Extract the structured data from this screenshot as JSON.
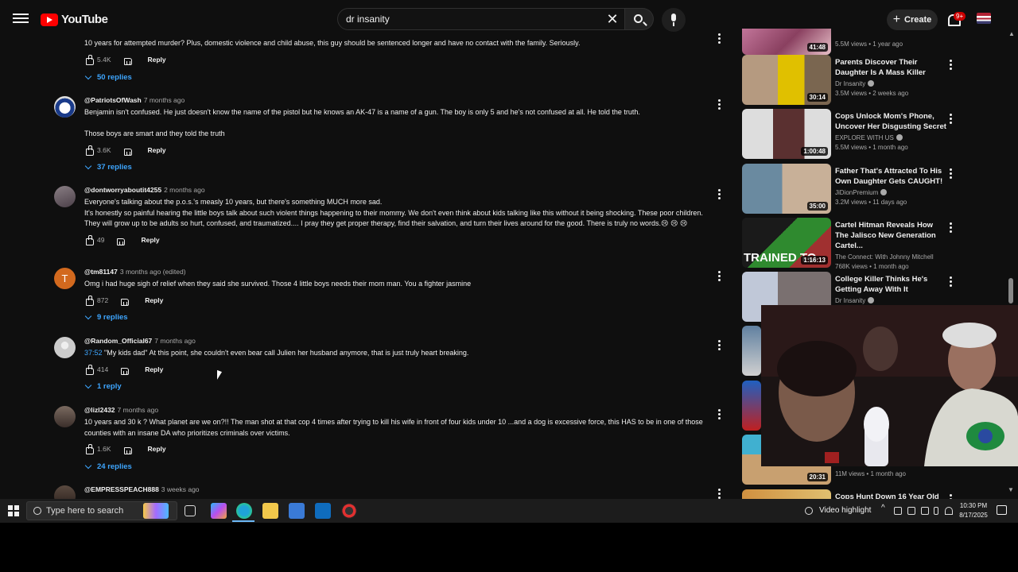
{
  "header": {
    "logo_text": "YouTube",
    "search_value": "dr insanity",
    "create_label": "Create",
    "notifications_badge": "9+"
  },
  "comments": [
    {
      "user": "",
      "time": "",
      "text": "10 years for attempted murder? Plus, domestic violence and child abuse,  this guy should be sentenced longer and have no contact with the family. Seriously.",
      "likes": "5.4K",
      "reply_label": "Reply",
      "replies": "50 replies"
    },
    {
      "user": "@PatriotsOfWash",
      "time": "7 months ago",
      "text": "Benjamin isn't confused. He just doesn't know the name of the pistol but he knows an AK-47 is a name of a gun. The boy is only 5 and he's not confused at all. He told the truth.\n\nThose boys are smart and they told the truth",
      "likes": "3.6K",
      "reply_label": "Reply",
      "replies": "37 replies"
    },
    {
      "user": "@dontworryaboutit4255",
      "time": "2 months ago",
      "text": "Everyone's talking about the p.o.s.'s measly 10 years, but there's something MUCH more sad.\nIt's honestly so painful hearing the little boys talk about such violent things happening to their mommy. We don't even think about kids talking like this without it being shocking. These poor children. They will grow up to be adults so hurt, confused, and traumatized.... I pray they get proper therapy, find their salvation, and turn their lives around for the good. There is truly no words.😢 😢 😢",
      "likes": "49",
      "reply_label": "Reply",
      "replies": ""
    },
    {
      "user": "@tm81147",
      "time": "3 months ago (edited)",
      "text": "Omg i had huge sigh of relief when they said she survived. Those 4 little boys needs their mom man. You a fighter jasmine",
      "likes": "872",
      "reply_label": "Reply",
      "replies": "9 replies",
      "avatar_letter": "T"
    },
    {
      "user": "@Random_Official67",
      "time": "7 months ago",
      "timestamp_link": "37:52",
      "text": " \"My kids dad\" At this point, she couldn't even bear call Julien her husband anymore, that is just truly heart breaking.",
      "likes": "414",
      "reply_label": "Reply",
      "replies": "1 reply"
    },
    {
      "user": "@lizl2432",
      "time": "7 months ago",
      "text": "10 years and 30 k ? What planet are we on?!! The man shot at that cop 4 times after trying to kill his wife in front of four kids under 10 ...and a dog is excessive force, this HAS to be in one of those counties with an insane DA who prioritizes criminals over victims.",
      "likes": "1.6K",
      "reply_label": "Reply",
      "replies": "24 replies"
    },
    {
      "user": "@EMPRESSPEACH888",
      "time": "3 weeks ago",
      "text": "",
      "likes": "",
      "reply_label": "",
      "replies": ""
    }
  ],
  "related": [
    {
      "title": "",
      "channel": "",
      "meta": "5.5M views • 1 year ago",
      "duration": "41:48"
    },
    {
      "title": "Parents Discover Their Daughter Is A Mass Killer",
      "channel": "Dr Insanity",
      "meta": "3.5M views • 2 weeks ago",
      "duration": "30:14"
    },
    {
      "title": "Cops Unlock Mom's Phone, Uncover Her Disgusting Secret",
      "channel": "EXPLORE WITH US",
      "meta": "5.5M views • 1 month ago",
      "duration": "1:00:48"
    },
    {
      "title": "Father That's Attracted To His Own Daughter Gets CAUGHT!",
      "channel": "JiDionPremium",
      "meta": "3.2M views • 11 days ago",
      "duration": "35:00"
    },
    {
      "title": "Cartel Hitman Reveals How The Jalisco New Generation Cartel...",
      "channel": "The Connect: With Johnny Mitchell",
      "meta": "768K views • 1 month ago",
      "duration": "1:16:13",
      "thumb_text": "TRAINED TO"
    },
    {
      "title": "College Killer Thinks He's Getting Away With It",
      "channel": "Dr Insanity",
      "meta": "",
      "duration": ""
    },
    {
      "title": "",
      "channel": "",
      "meta": "11M views • 1 month ago",
      "duration": "20:31"
    },
    {
      "title": "Cops Hunt Down 16 Year Old",
      "channel": "",
      "meta": "",
      "duration": ""
    }
  ],
  "taskbar": {
    "search_placeholder": "Type here to search",
    "video_highlight": "Video highlight",
    "time": "10:30 PM",
    "date": "8/17/2025"
  },
  "colors": {
    "background": "#0f0f0f",
    "link_blue": "#3ea6ff",
    "brand_red": "#ff0000"
  },
  "icons": [
    "menu-icon",
    "youtube-logo-icon",
    "clear-icon",
    "search-icon",
    "mic-icon",
    "plus-icon",
    "bell-icon",
    "thumb-up-icon",
    "thumb-down-icon",
    "chevron-down-icon",
    "more-vert-icon",
    "windows-start-icon"
  ]
}
